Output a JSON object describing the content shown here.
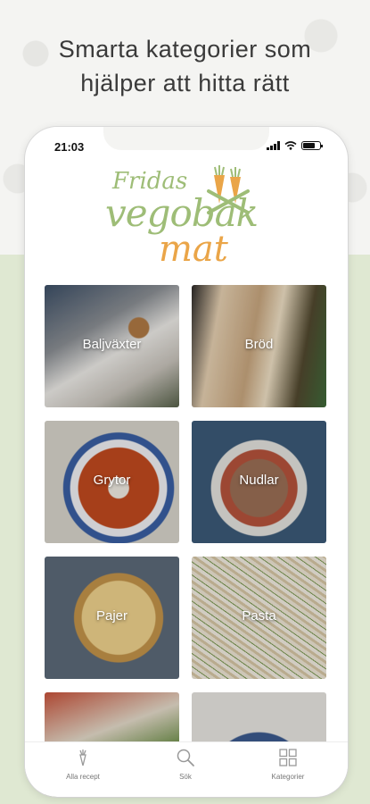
{
  "headline": {
    "line1": "Smarta kategorier som",
    "line2": "hjälper att hitta rätt"
  },
  "status_bar": {
    "time": "21:03"
  },
  "logo": {
    "line1": "Fridas",
    "line2": "vegobak",
    "line3": "mat"
  },
  "categories": [
    {
      "label": "Baljväxter"
    },
    {
      "label": "Bröd"
    },
    {
      "label": "Grytor"
    },
    {
      "label": "Nudlar"
    },
    {
      "label": "Pajer"
    },
    {
      "label": "Pasta"
    },
    {
      "label": ""
    },
    {
      "label": ""
    }
  ],
  "tabbar": {
    "items": [
      {
        "label": "Alla recept",
        "icon": "carrot-icon"
      },
      {
        "label": "Sök",
        "icon": "search-icon"
      },
      {
        "label": "Kategorier",
        "icon": "grid-icon"
      }
    ]
  }
}
